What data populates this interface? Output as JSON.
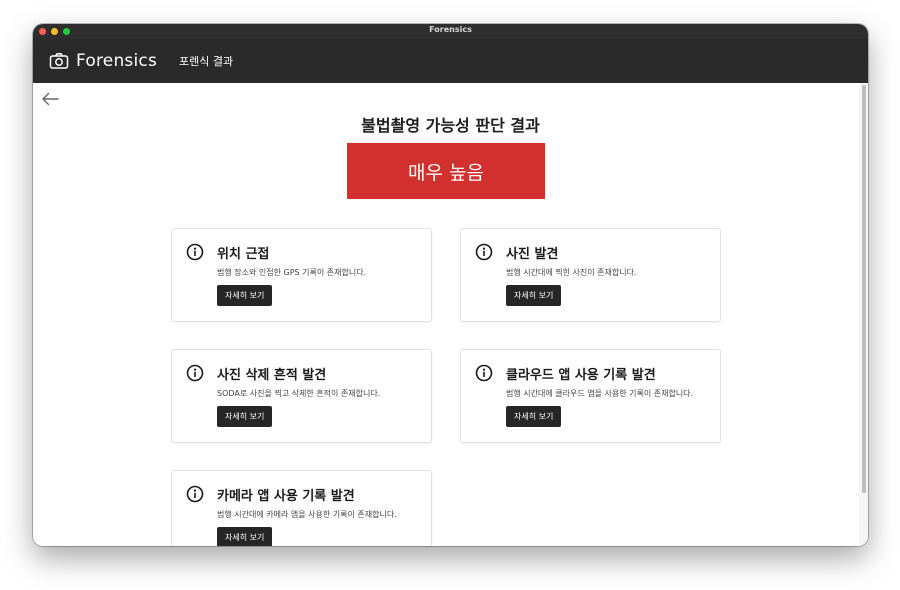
{
  "window": {
    "title": "Forensics"
  },
  "appbar": {
    "brand": "Forensics",
    "subtitle": "포렌식 결과"
  },
  "result": {
    "title": "불법촬영 가능성 판단 결과",
    "level": "매우 높음",
    "level_color": "#d22f2f"
  },
  "cards": [
    {
      "title": "위치 근접",
      "description": "범행 장소와 인접한 GPS 기록이 존재합니다.",
      "button": "자세히 보기"
    },
    {
      "title": "사진 발견",
      "description": "범행 시간대에 찍힌 사진이 존재합니다.",
      "button": "자세히 보기"
    },
    {
      "title": "사진 삭제 흔적 발견",
      "description": "SODA로 사진을 찍고 삭제한 흔적이 존재합니다.",
      "button": "자세히 보기"
    },
    {
      "title": "클라우드 앱 사용 기록 발견",
      "description": "범행 시간대에 클라우드 앱을 사용한 기록이 존재합니다.",
      "button": "자세히 보기"
    },
    {
      "title": "카메라 앱 사용 기록 발견",
      "description": "범행 시간대에 카메라 앱을 사용한 기록이 존재합니다.",
      "button": "자세히 보기"
    }
  ]
}
